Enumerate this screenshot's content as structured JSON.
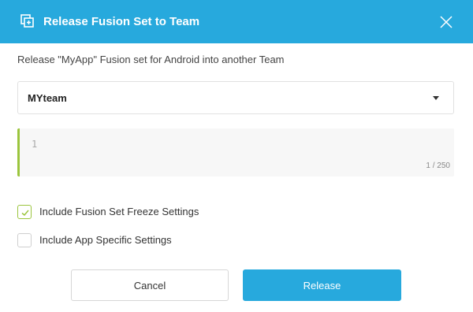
{
  "colors": {
    "header_bg": "#27a9dd",
    "accent_green": "#9bc53d",
    "primary_button": "#27a9dd"
  },
  "header": {
    "title": "Release Fusion Set to Team",
    "icon": "release-copy-icon",
    "close_icon": "close-icon"
  },
  "description": "Release \"MyApp\" Fusion set for Android into another Team",
  "team_select": {
    "selected": "MYteam",
    "icon": "caret-down-icon"
  },
  "editor": {
    "line_number": "1",
    "value": "",
    "counter": "1 / 250"
  },
  "options": [
    {
      "label": "Include Fusion Set Freeze Settings",
      "checked": true
    },
    {
      "label": "Include App Specific Settings",
      "checked": false
    }
  ],
  "actions": {
    "cancel_label": "Cancel",
    "release_label": "Release"
  }
}
